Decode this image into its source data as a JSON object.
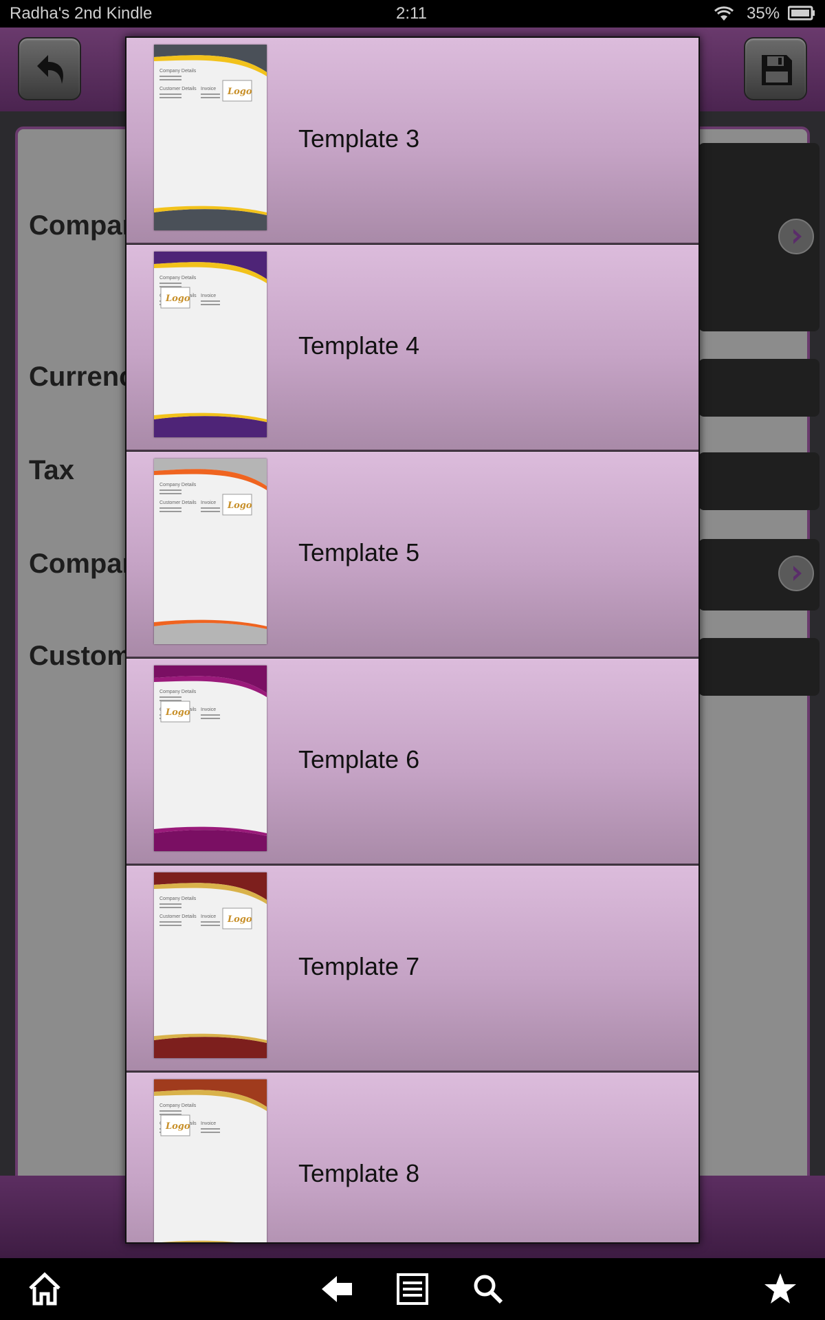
{
  "status_bar": {
    "device_name": "Radha's 2nd Kindle",
    "time": "2:11",
    "battery_percent": "35%",
    "icons": [
      "wifi-icon",
      "battery-icon"
    ]
  },
  "toolbar": {
    "back_icon": "undo-arrow-icon",
    "save_icon": "floppy-disk-icon"
  },
  "form": {
    "labels": [
      "Compan",
      "Currency",
      "Tax",
      "Compan",
      "Custom"
    ]
  },
  "template_list": {
    "items": [
      {
        "label": "Template 3",
        "accent": "#f2c21b",
        "base": "#4a5058"
      },
      {
        "label": "Template 4",
        "accent": "#f2c21b",
        "base": "#4e2477"
      },
      {
        "label": "Template 5",
        "accent": "#ef6420",
        "base": "#b5b5b5"
      },
      {
        "label": "Template 6",
        "accent": "#9a1a7a",
        "base": "#7a0f63"
      },
      {
        "label": "Template 7",
        "accent": "#d9b24a",
        "base": "#7d1f1d"
      },
      {
        "label": "Template 8",
        "accent": "#d9b24a",
        "base": "#a03b1d"
      }
    ],
    "thumb_text": {
      "company": "Company Details",
      "customer": "Customer Details",
      "invoice": "Invoice",
      "logo": "Logo"
    }
  },
  "navbar": {
    "icons": [
      "home-icon",
      "back-arrow-icon",
      "menu-icon",
      "search-icon",
      "favorites-star-icon"
    ]
  },
  "colors": {
    "row_gradient_top": "#dcbcdc",
    "row_gradient_bottom": "#a98aa8",
    "header_purple": "#6a3a6d"
  }
}
